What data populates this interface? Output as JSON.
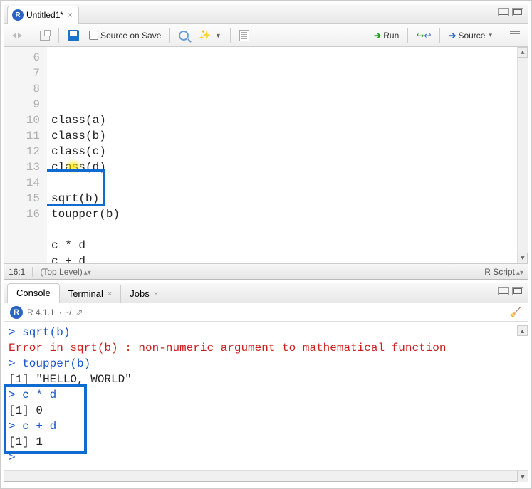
{
  "source": {
    "tab": {
      "title": "Untitled1*"
    },
    "toolbar": {
      "source_on_save": "Source on Save",
      "run": "Run",
      "source": "Source"
    },
    "lines": [
      {
        "num": "6",
        "text": "class(a)"
      },
      {
        "num": "7",
        "text": "class(b)"
      },
      {
        "num": "8",
        "text": "class(c)"
      },
      {
        "num": "9",
        "text": "class(d)"
      },
      {
        "num": "10",
        "text": ""
      },
      {
        "num": "11",
        "text": "sqrt(b)"
      },
      {
        "num": "12",
        "text": "toupper(b)"
      },
      {
        "num": "13",
        "text": ""
      },
      {
        "num": "14",
        "text": "c * d"
      },
      {
        "num": "15",
        "text": "c + d"
      },
      {
        "num": "16",
        "text": ""
      }
    ],
    "status": {
      "cursor": "16:1",
      "scope": "(Top Level)",
      "lang": "R Script"
    }
  },
  "console": {
    "tabs": {
      "console": "Console",
      "terminal": "Terminal",
      "jobs": "Jobs"
    },
    "header": {
      "version": "R 4.1.1",
      "path": "· ~/"
    },
    "lines": [
      {
        "cls": "co-prompt",
        "text": "> sqrt(b)"
      },
      {
        "cls": "co-err",
        "text": "Error in sqrt(b) : non-numeric argument to mathematical function"
      },
      {
        "cls": "co-prompt",
        "text": "> toupper(b)"
      },
      {
        "cls": "co-out",
        "text": "[1] \"HELLO, WORLD\""
      },
      {
        "cls": "co-prompt",
        "text": "> c * d"
      },
      {
        "cls": "co-out",
        "text": "[1] 0"
      },
      {
        "cls": "co-prompt",
        "text": "> c + d"
      },
      {
        "cls": "co-out",
        "text": "[1] 1"
      },
      {
        "cls": "co-prompt",
        "text": "> "
      }
    ]
  }
}
